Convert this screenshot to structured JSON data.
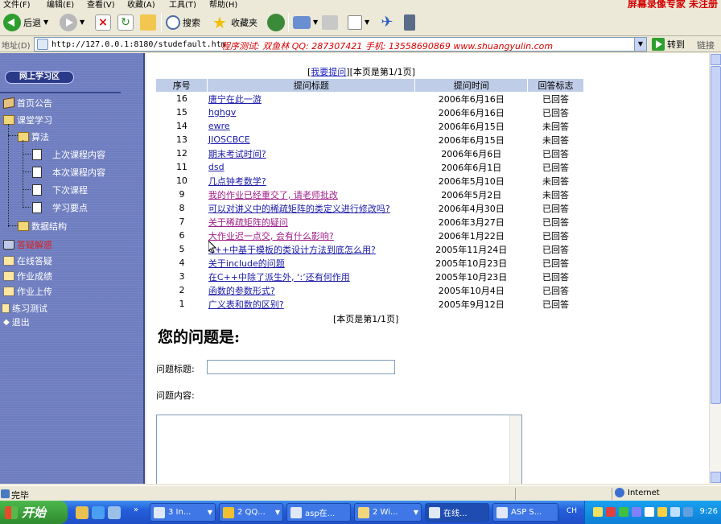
{
  "menubar": {
    "items": [
      "文件(F)",
      "编辑(E)",
      "查看(V)",
      "收藏(A)",
      "工具(T)",
      "帮助(H)"
    ],
    "watermark": "屏幕录像专家 未注册"
  },
  "toolbar": {
    "back_label": "后退",
    "search_label": "搜索",
    "favorites_label": "收藏夹"
  },
  "address": {
    "label": "地址(D)",
    "url": "http://127.0.0.1:8180/studefault.htm",
    "overlay": "程序测试: 双鱼林  QQ: 287307421  手机: 13558690869   www.shuangyulin.com",
    "go_label": "转到",
    "links_label": "链接"
  },
  "nav": {
    "title": "网上学习区",
    "items": [
      {
        "label": "首页公告",
        "icon": "book-icon"
      },
      {
        "label": "课堂学习",
        "icon": "folder-icon"
      },
      {
        "label": "算法",
        "icon": "folder-icon"
      },
      {
        "label": "上次课程内容",
        "icon": "page-icon"
      },
      {
        "label": "本次课程内容",
        "icon": "page-icon"
      },
      {
        "label": "下次课程",
        "icon": "page-icon"
      },
      {
        "label": "学习要点",
        "icon": "page-icon"
      },
      {
        "label": "数据结构",
        "icon": "folder-icon"
      },
      {
        "label": "答疑解惑",
        "icon": "question-icon"
      },
      {
        "label": "在线答疑",
        "icon": "doc-icon"
      },
      {
        "label": "作业成绩",
        "icon": "doc-icon"
      },
      {
        "label": "作业上传",
        "icon": "doc-icon"
      },
      {
        "label": "练习测试",
        "icon": "doc-icon"
      },
      {
        "label": "退出",
        "icon": "exit-icon"
      }
    ]
  },
  "pager": {
    "ask_link": "我要提问",
    "page_info": "[本页是第1/1页]",
    "bottom": "[本页是第1/1页]"
  },
  "table": {
    "headers": [
      "序号",
      "提问标题",
      "提问时间",
      "回答标志"
    ],
    "rows": [
      {
        "no": "16",
        "title": "唐宁在此一游",
        "date": "2006年6月16日",
        "flag": "已回答"
      },
      {
        "no": "15",
        "title": "hghgv",
        "date": "2006年6月16日",
        "flag": "已回答"
      },
      {
        "no": "14",
        "title": "ewre",
        "date": "2006年6月15日",
        "flag": "未回答"
      },
      {
        "no": "13",
        "title": "JIOSCBCE",
        "date": "2006年6月15日",
        "flag": "未回答"
      },
      {
        "no": "12",
        "title": "期末考试时间?",
        "date": "2006年6月6日",
        "flag": "已回答"
      },
      {
        "no": "11",
        "title": "dsd",
        "date": "2006年6月1日",
        "flag": "已回答"
      },
      {
        "no": "10",
        "title": "几点钟考数学?",
        "date": "2006年5月10日",
        "flag": "未回答"
      },
      {
        "no": "9",
        "title": "我的作业已经重交了, 请老师批改",
        "date": "2006年5月2日",
        "flag": "未回答"
      },
      {
        "no": "8",
        "title": "可以对讲义中的稀疏矩阵的类定义进行修改吗?",
        "date": "2006年4月30日",
        "flag": "已回答"
      },
      {
        "no": "7",
        "title": "关于稀疏矩阵的疑问",
        "date": "2006年3月27日",
        "flag": "已回答"
      },
      {
        "no": "6",
        "title": "大作业迟一点交, 会有什么影响?",
        "date": "2006年1月22日",
        "flag": "已回答"
      },
      {
        "no": "5",
        "title": "C++中基于模板的类设计方法到底怎么用?",
        "date": "2005年11月24日",
        "flag": "已回答"
      },
      {
        "no": "4",
        "title": "关于include的问题",
        "date": "2005年10月23日",
        "flag": "已回答"
      },
      {
        "no": "3",
        "title": "在C++中除了派生外, ‘:’还有何作用",
        "date": "2005年10月23日",
        "flag": "已回答"
      },
      {
        "no": "2",
        "title": "函数的参数形式?",
        "date": "2005年10月4日",
        "flag": "已回答"
      },
      {
        "no": "1",
        "title": "广义表和数的区别?",
        "date": "2005年9月12日",
        "flag": "已回答"
      }
    ]
  },
  "form": {
    "heading": "您的问题是:",
    "title_label": "问题标题:",
    "title_value": "",
    "content_label": "问题内容:",
    "content_value": ""
  },
  "status": {
    "text": "完毕",
    "zone": "Internet"
  },
  "taskbar": {
    "start": "开始",
    "tasks": [
      "3 In...",
      "2 QQ...",
      "asp在...",
      "2 Wi...",
      "在线...",
      "ASP S..."
    ],
    "lang": "CH",
    "clock": "9:26"
  }
}
